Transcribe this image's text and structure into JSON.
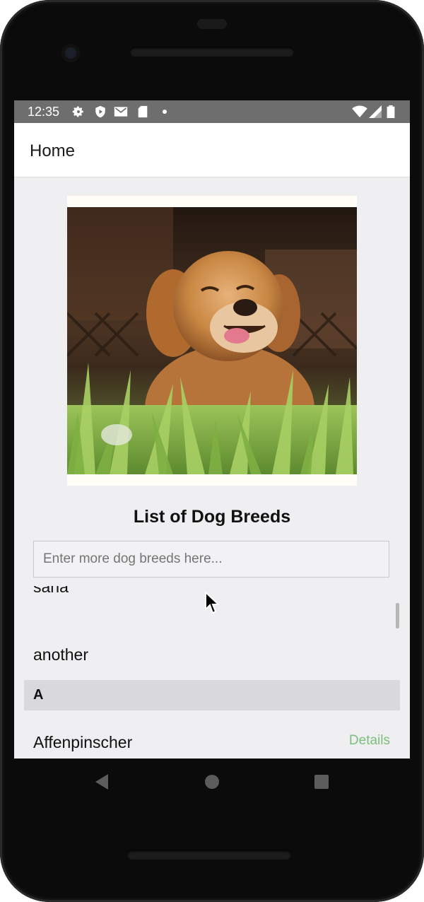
{
  "status_bar": {
    "time": "12:35",
    "icons": [
      "gear-icon",
      "shield-icon",
      "gmail-icon",
      "sdcard-icon",
      "dot-icon",
      "wifi-icon",
      "signal-icon",
      "battery-icon"
    ]
  },
  "app_bar": {
    "title": "Home"
  },
  "hero_image": {
    "subject": "golden-retriever-in-grass"
  },
  "list": {
    "title": "List of Dog Breeds",
    "input_placeholder": "Enter more dog breeds here...",
    "partial_item": "sana",
    "items_before": [
      "another"
    ],
    "section_header": "A",
    "items": [
      {
        "label": "Affenpinscher",
        "action": "Details"
      }
    ]
  },
  "colors": {
    "status_bar": "#6e6e6e",
    "screen_bg": "#efeef1",
    "section_bg": "#d9d8dc",
    "details_link": "#7dbf7d"
  },
  "nav_bar": {
    "icons": [
      "back-icon",
      "home-icon",
      "recents-icon"
    ]
  }
}
